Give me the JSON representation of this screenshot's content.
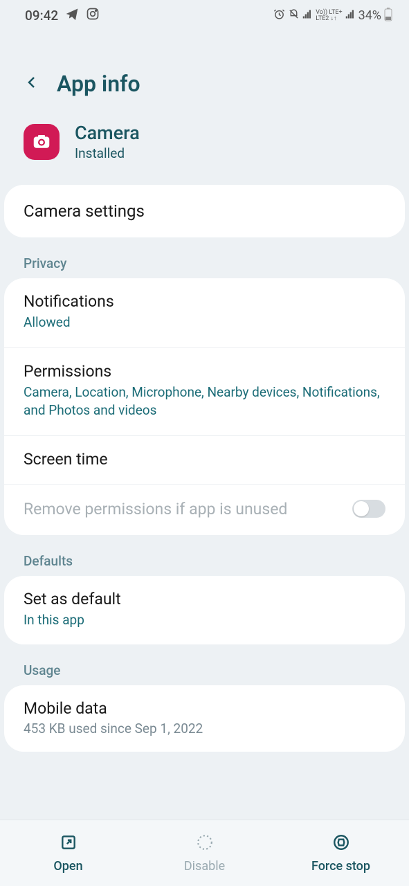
{
  "status": {
    "time": "09:42",
    "battery": "34%"
  },
  "header": {
    "title": "App info"
  },
  "app": {
    "name": "Camera",
    "status": "Installed"
  },
  "camera_settings": {
    "label": "Camera settings"
  },
  "sections": {
    "privacy": {
      "label": "Privacy"
    },
    "defaults": {
      "label": "Defaults"
    },
    "usage": {
      "label": "Usage"
    }
  },
  "privacy": {
    "notifications": {
      "title": "Notifications",
      "sub": "Allowed"
    },
    "permissions": {
      "title": "Permissions",
      "sub": "Camera, Location, Microphone, Nearby devices, Notifications, and Photos and videos"
    },
    "screen_time": {
      "title": "Screen time"
    },
    "remove_perms": {
      "title": "Remove permissions if app is unused"
    }
  },
  "defaults": {
    "set_default": {
      "title": "Set as default",
      "sub": "In this app"
    }
  },
  "usage": {
    "mobile_data": {
      "title": "Mobile data",
      "sub": "453 KB used since Sep 1, 2022"
    }
  },
  "bottom": {
    "open": "Open",
    "disable": "Disable",
    "force_stop": "Force stop"
  }
}
